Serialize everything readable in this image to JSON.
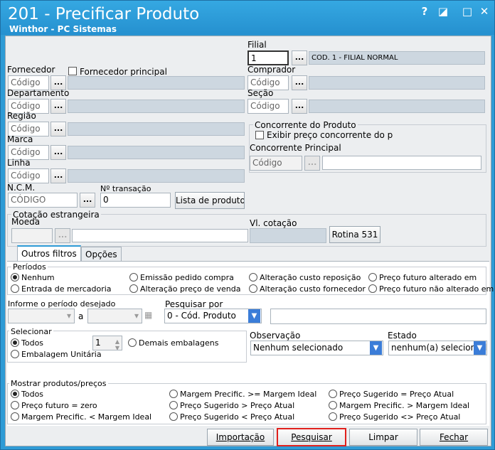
{
  "window": {
    "title": "201 - Precificar Produto",
    "subtitle": "Winthor - PC Sistemas",
    "help": "?",
    "restore": "◪",
    "minimize": "□",
    "close": "✕"
  },
  "filters": {
    "filial_label": "Filial",
    "filial_value": "1",
    "filial_desc": "COD. 1 - FILIAL NORMAL",
    "fornecedor_label": "Fornecedor",
    "fornecedor_principal": "Fornecedor principal",
    "comprador_label": "Comprador",
    "departamento_label": "Departamento",
    "secao_label": "Seção",
    "regiao_label": "Região",
    "marca_label": "Marca",
    "linha_label": "Linha",
    "ncm_label": "N.C.M.",
    "ncm_placeholder": "CÓDIGO",
    "ntransacao_label": "Nº transação",
    "ntransacao_value": "0",
    "lista_produtos": "Lista de produtos",
    "codigo_placeholder": "Código",
    "dots": "...",
    "concorrente_title": "Concorrente do Produto",
    "exibir_preco": "Exibir preço concorrente do pro",
    "concorrente_principal": "Concorrente Principal",
    "cotacao_title": "Cotação estrangeira",
    "moeda_label": "Moeda",
    "vl_cotacao_label": "Vl. cotação",
    "rotina_531": "Rotina 531"
  },
  "tabs": [
    {
      "label": "Outros filtros"
    },
    {
      "label": "Opções"
    }
  ],
  "periodos": {
    "title": "Períodos",
    "options": [
      {
        "label": "Nenhum",
        "checked": true
      },
      {
        "label": "Emissão pedido compra",
        "checked": false
      },
      {
        "label": "Alteração custo reposição",
        "checked": false
      },
      {
        "label": "Preço futuro alterado em",
        "checked": false
      },
      {
        "label": "Entrada de mercadoria",
        "checked": false
      },
      {
        "label": "Alteração preço de venda",
        "checked": false
      },
      {
        "label": "Alteração custo fornecedor",
        "checked": false
      },
      {
        "label": "Preço futuro não alterado em",
        "checked": false
      }
    ]
  },
  "periodo_desejado": {
    "label": "Informe o período desejado",
    "a": "a"
  },
  "pesquisar_por": {
    "label": "Pesquisar por",
    "value": "0 - Cód. Produto"
  },
  "selecionar": {
    "title": "Selecionar",
    "todos": "Todos",
    "embalagem": "Embalagem Unitária",
    "qtd": "1",
    "demais": "Demais embalagens"
  },
  "observacao": {
    "label": "Observação",
    "value": "Nenhum selecionado"
  },
  "estado": {
    "label": "Estado",
    "value": "nenhum(a) selecionado"
  },
  "mostrar": {
    "title": "Mostrar produtos/preços",
    "options": [
      {
        "label": "Todos",
        "checked": true
      },
      {
        "label": "Margem Precific. >= Margem Ideal",
        "checked": false
      },
      {
        "label": "Preço Sugerido = Preço Atual",
        "checked": false
      },
      {
        "label": "Preço futuro = zero",
        "checked": false
      },
      {
        "label": "Preço Sugerido > Preço Atual",
        "checked": false
      },
      {
        "label": "Margem Precific. > Margem Ideal",
        "checked": false
      },
      {
        "label": "Margem Precific. < Margem Ideal",
        "checked": false
      },
      {
        "label": "Preço Sugerido < Preço Atual",
        "checked": false
      },
      {
        "label": "Preço Sugerido <> Preço Atual",
        "checked": false
      }
    ]
  },
  "buttons": {
    "importacao": "Importação",
    "pesquisar": "Pesquisar",
    "limpar": "Limpar",
    "fechar": "Fechar"
  },
  "colors": {
    "titlebar": "#2e9bd6",
    "highlight": "#e0201c"
  }
}
